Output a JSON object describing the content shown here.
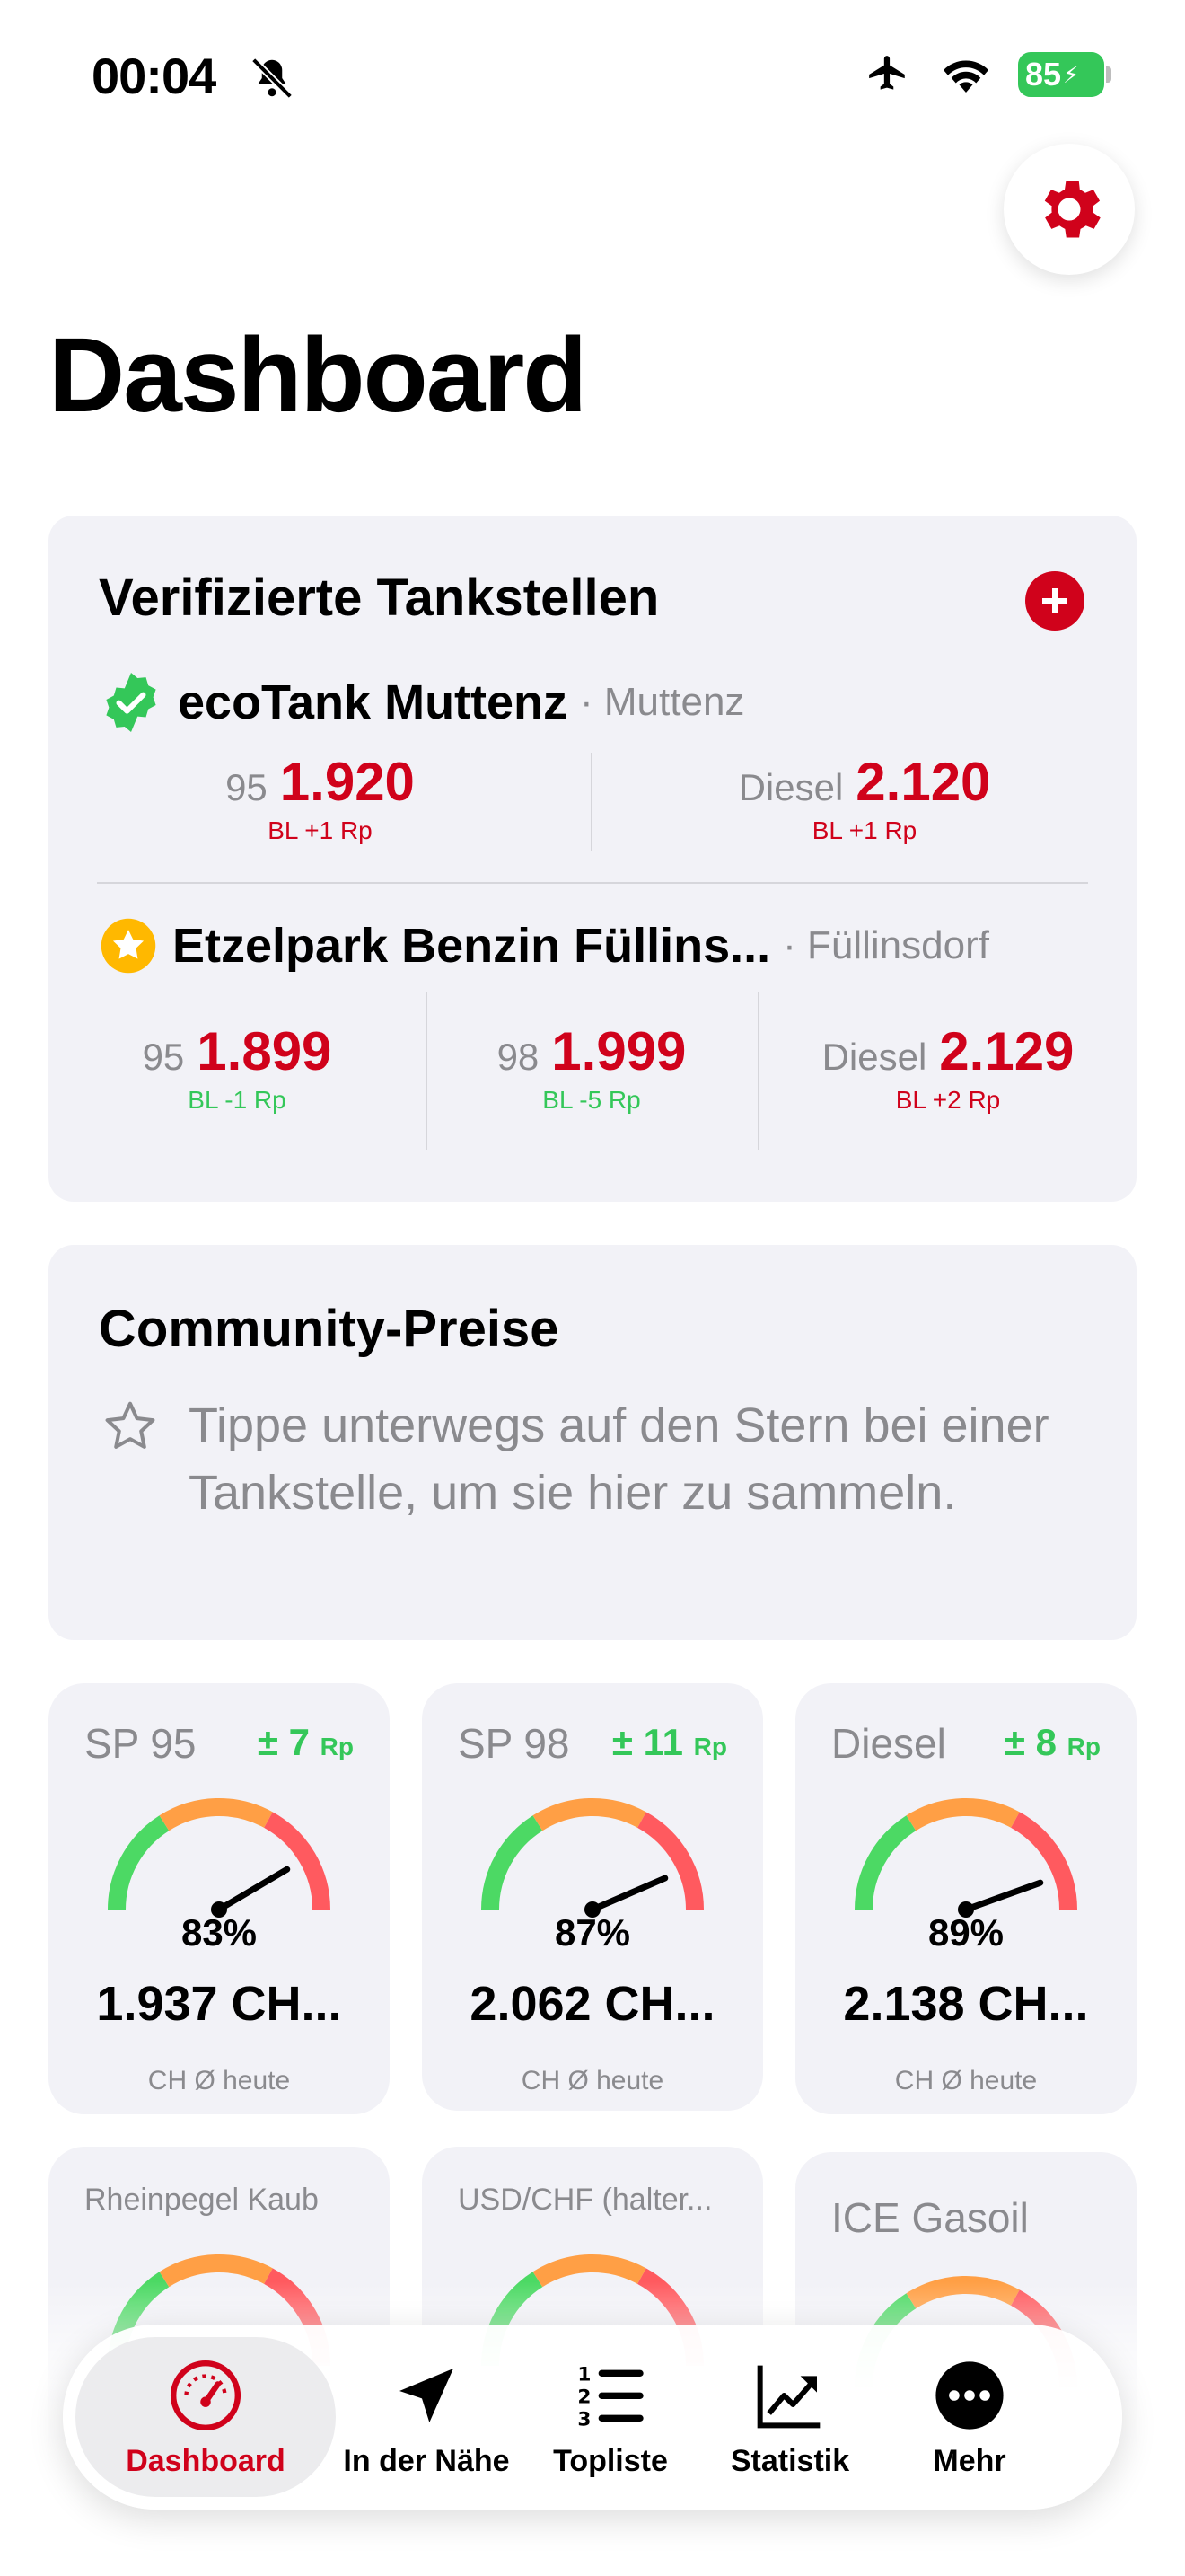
{
  "status_bar": {
    "time": "00:04",
    "battery": "85"
  },
  "page": {
    "title": "Dashboard"
  },
  "colors": {
    "accent": "#d0021b",
    "positive": "#34c759",
    "muted": "#8a8a8e",
    "card_bg": "#f2f2f7"
  },
  "verified": {
    "title": "Verifizierte Tankstellen",
    "stations": [
      {
        "name": "ecoTank Muttenz",
        "city": "· Muttenz",
        "badge_icon": "verified-badge-icon",
        "prices": [
          {
            "fuel": "95",
            "price": "1.920",
            "delta": "BL +1 Rp"
          },
          {
            "fuel": "Diesel",
            "price": "2.120",
            "delta": "BL +1 Rp"
          }
        ]
      },
      {
        "name": "Etzelpark Benzin Füllins...",
        "city": "· Füllinsdorf",
        "badge_icon": "star-badge-icon",
        "prices": [
          {
            "fuel": "95",
            "price": "1.899",
            "delta": "BL -1 Rp"
          },
          {
            "fuel": "98",
            "price": "1.999",
            "delta": "BL -5 Rp"
          },
          {
            "fuel": "Diesel",
            "price": "2.129",
            "delta": "BL +2 Rp"
          }
        ]
      }
    ]
  },
  "community": {
    "title": "Community-Preise",
    "text": "Tippe unterwegs auf den Stern bei einer Tankstelle, um sie hier zu sammeln."
  },
  "gauges": [
    {
      "name": "SP 95",
      "change": "± 7",
      "unit": "Rp",
      "percent_label": "83%",
      "percent": 0.83,
      "price": "1.937 CH...",
      "caption": "CH Ø heute"
    },
    {
      "name": "SP 98",
      "change": "± 11",
      "unit": "Rp",
      "percent_label": "87%",
      "percent": 0.87,
      "price": "2.062 CH...",
      "caption": "CH Ø heute"
    },
    {
      "name": "Diesel",
      "change": "± 8",
      "unit": "Rp",
      "percent_label": "89%",
      "percent": 0.89,
      "price": "2.138 CH...",
      "caption": "CH Ø heute"
    }
  ],
  "more_tiles": [
    {
      "name": "Rheinpegel Kaub"
    },
    {
      "name": "USD/CHF (halter..."
    },
    {
      "name": "ICE Gasoil"
    }
  ],
  "tabbar": {
    "items": [
      {
        "label": "Dashboard",
        "icon": "speedometer-icon",
        "active": true
      },
      {
        "label": "In der Nähe",
        "icon": "location-arrow-icon",
        "active": false
      },
      {
        "label": "Topliste",
        "icon": "numbered-list-icon",
        "active": false
      },
      {
        "label": "Statistik",
        "icon": "chart-trend-icon",
        "active": false
      },
      {
        "label": "Mehr",
        "icon": "more-icon",
        "active": false
      }
    ]
  }
}
